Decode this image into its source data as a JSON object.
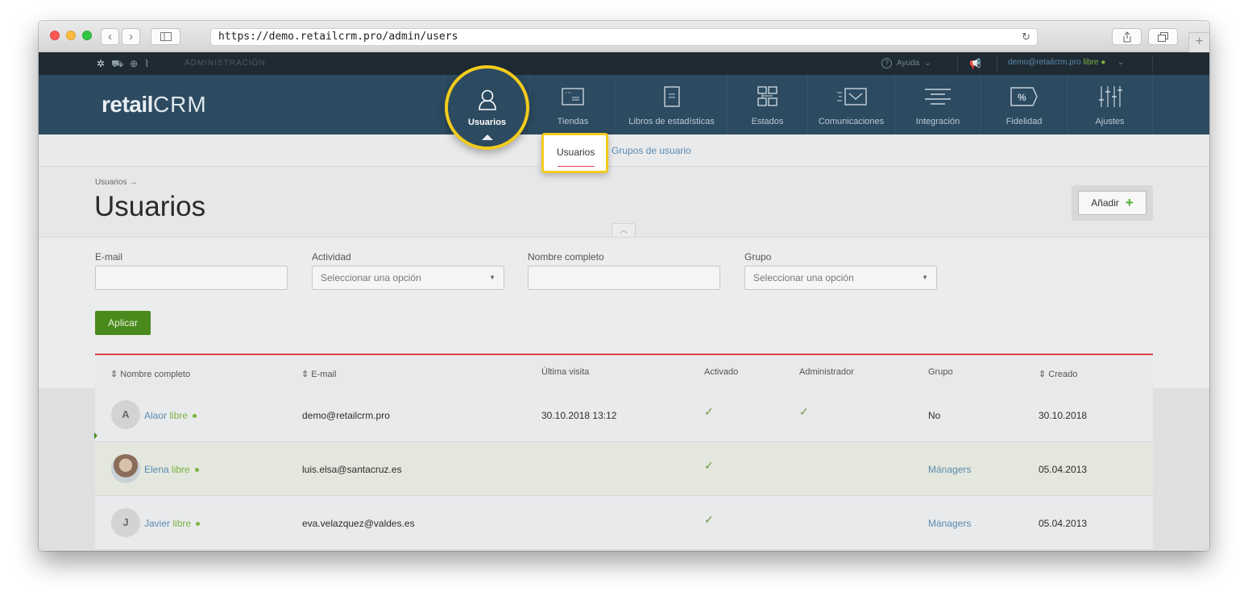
{
  "browser": {
    "url": "https://demo.retailcrm.pro/admin/users"
  },
  "topbar": {
    "section": "ADMINISTRACIÓN",
    "help": "Ayuda",
    "user_email": "demo@retailcrm.pro",
    "user_status": "libre"
  },
  "logo": {
    "text1": "retail",
    "text2": "CRM"
  },
  "nav": {
    "items": [
      {
        "label": "Usuarios",
        "icon": "user-icon"
      },
      {
        "label": "Tiendas",
        "icon": "store-icon"
      },
      {
        "label": "Libros de estadísticas",
        "icon": "book-icon"
      },
      {
        "label": "Estados",
        "icon": "status-grid-icon"
      },
      {
        "label": "Comunicaciones",
        "icon": "envelope-icon"
      },
      {
        "label": "Integración",
        "icon": "integration-icon"
      },
      {
        "label": "Fidelidad",
        "icon": "percent-tag-icon"
      },
      {
        "label": "Ajustes",
        "icon": "sliders-icon"
      }
    ]
  },
  "subnav": {
    "active": "Usuarios",
    "other": "Grupos de usuario"
  },
  "page": {
    "breadcrumb": "Usuarios →",
    "title": "Usuarios",
    "add_button": "Añadir"
  },
  "filters": {
    "email_label": "E-mail",
    "activity_label": "Actividad",
    "activity_placeholder": "Seleccionar una opción",
    "fullname_label": "Nombre completo",
    "group_label": "Grupo",
    "group_placeholder": "Seleccionar una opción",
    "apply": "Aplicar"
  },
  "table": {
    "headers": [
      "Nombre completo",
      "E-mail",
      "Última visita",
      "Activado",
      "Administrador",
      "Grupo",
      "Creado"
    ],
    "rows": [
      {
        "initial": "A",
        "name": "Alaor",
        "status": "libre",
        "email": "demo@retailcrm.pro",
        "last_visit": "30.10.2018 13:12",
        "active": true,
        "admin": true,
        "group": "No",
        "created": "30.10.2018"
      },
      {
        "initial": "",
        "name": "Elena",
        "status": "libre",
        "email": "luis.elsa@santacruz.es",
        "last_visit": "",
        "active": true,
        "admin": false,
        "group": "Mánagers",
        "created": "05.04.2013"
      },
      {
        "initial": "J",
        "name": "Javier",
        "status": "libre",
        "email": "eva.velazquez@valdes.es",
        "last_visit": "",
        "active": true,
        "admin": false,
        "group": "Mánagers",
        "created": "05.04.2013"
      }
    ]
  },
  "colors": {
    "nav_bg": "#2c4a60",
    "highlight": "#f2cb1d",
    "accent_green": "#4a8a1c",
    "link": "#5b8bb0"
  }
}
